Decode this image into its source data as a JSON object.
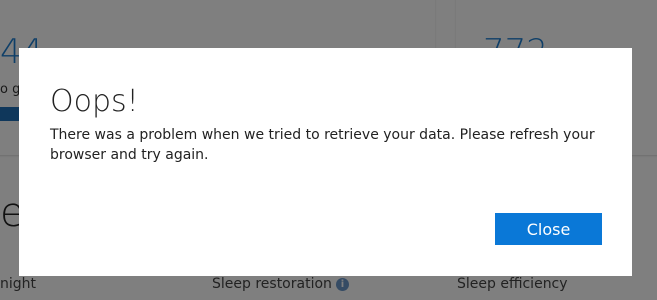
{
  "background": {
    "metric_left_value": "44",
    "metric_right_value": "772",
    "metric_left_caption": "o g",
    "section_title": "ee",
    "footer": {
      "left_label": "night",
      "mid_label": "Sleep restoration",
      "right_label": "Sleep efficiency"
    }
  },
  "dialog": {
    "title": "Oops!",
    "message": "There was a problem when we tried to retrieve your data. Please refresh your browser and try again.",
    "close_label": "Close"
  },
  "colors": {
    "accent": "#0a78d7",
    "metric_blue": "#1f7fd1",
    "overlay": "rgba(0,0,0,0.50)"
  },
  "icons": {
    "info": "info-icon"
  }
}
